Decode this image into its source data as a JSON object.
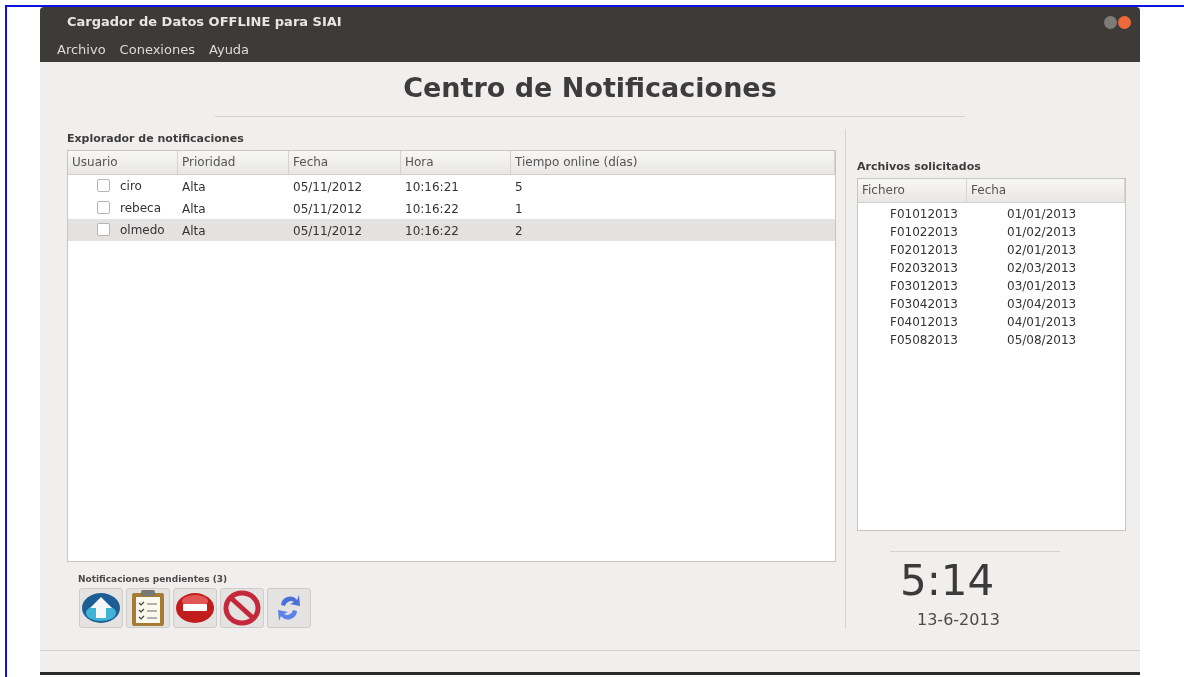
{
  "window": {
    "title": "Cargador de Datos OFFLINE para SIAI"
  },
  "menu": [
    "Archivo",
    "Conexiones",
    "Ayuda"
  ],
  "heading": "Centro de Notificaciones",
  "explorer": {
    "label": "Explorador de notificaciones",
    "columns": [
      "Usuario",
      "Prioridad",
      "Fecha",
      "Hora",
      "Tiempo online (días)"
    ],
    "rows": [
      {
        "checked": false,
        "selected": false,
        "cells": [
          "ciro",
          "Alta",
          "05/11/2012",
          "10:16:21",
          "5"
        ]
      },
      {
        "checked": false,
        "selected": false,
        "cells": [
          "rebeca",
          "Alta",
          "05/11/2012",
          "10:16:22",
          "1"
        ]
      },
      {
        "checked": false,
        "selected": true,
        "cells": [
          "olmedo",
          "Alta",
          "05/11/2012",
          "10:16:22",
          "2"
        ]
      }
    ]
  },
  "pending": {
    "label": "Notificaciones pendientes (3)",
    "tools": [
      {
        "kind": "upload"
      },
      {
        "kind": "clipboard"
      },
      {
        "kind": "stop"
      },
      {
        "kind": "forbidden"
      },
      {
        "kind": "refresh"
      }
    ]
  },
  "files": {
    "label": "Archivos solicitados",
    "columns": [
      "Fichero",
      "Fecha"
    ],
    "rows": [
      [
        "F01012013",
        "01/01/2013"
      ],
      [
        "F01022013",
        "01/02/2013"
      ],
      [
        "F02012013",
        "02/01/2013"
      ],
      [
        "F02032013",
        "02/03/2013"
      ],
      [
        "F03012013",
        "03/01/2013"
      ],
      [
        "F03042013",
        "03/04/2013"
      ],
      [
        "F04012013",
        "04/01/2013"
      ],
      [
        "F05082013",
        "05/08/2013"
      ]
    ]
  },
  "clock": {
    "time": "5:14",
    "date": "13-6-2013"
  }
}
